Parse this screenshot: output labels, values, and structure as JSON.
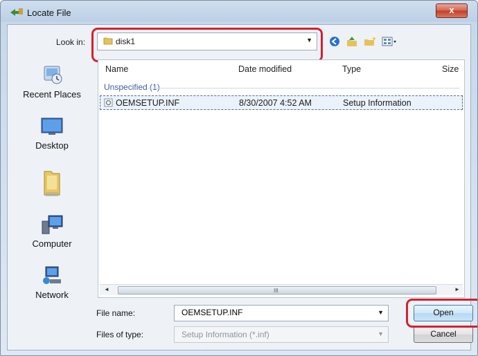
{
  "window": {
    "title": "Locate File",
    "close_label": "x"
  },
  "toolbar": {
    "look_in_label": "Look in:",
    "look_in_value": "disk1",
    "icons": [
      "back-icon",
      "up-folder-icon",
      "new-folder-icon",
      "views-menu-icon"
    ]
  },
  "places": [
    {
      "label": "Recent Places",
      "icon": "recent-places-icon"
    },
    {
      "label": "Desktop",
      "icon": "desktop-icon"
    },
    {
      "label": "",
      "icon": "user-folder-icon"
    },
    {
      "label": "Computer",
      "icon": "computer-icon"
    },
    {
      "label": "Network",
      "icon": "network-icon"
    }
  ],
  "file_list": {
    "columns": [
      "Name",
      "Date modified",
      "Type",
      "Size"
    ],
    "group": "Unspecified (1)",
    "rows": [
      {
        "name": "OEMSETUP.INF",
        "date": "8/30/2007 4:52 AM",
        "type": "Setup Information",
        "size": ""
      }
    ],
    "scroll_grip": "III"
  },
  "form": {
    "file_name_label": "File name:",
    "file_name_value": "OEMSETUP.INF",
    "file_type_label": "Files of type:",
    "file_type_value": "Setup Information (*.inf)",
    "open_label": "Open",
    "cancel_label": "Cancel"
  },
  "colors": {
    "highlight": "#d5202e",
    "group_header": "#3c5ea8"
  }
}
